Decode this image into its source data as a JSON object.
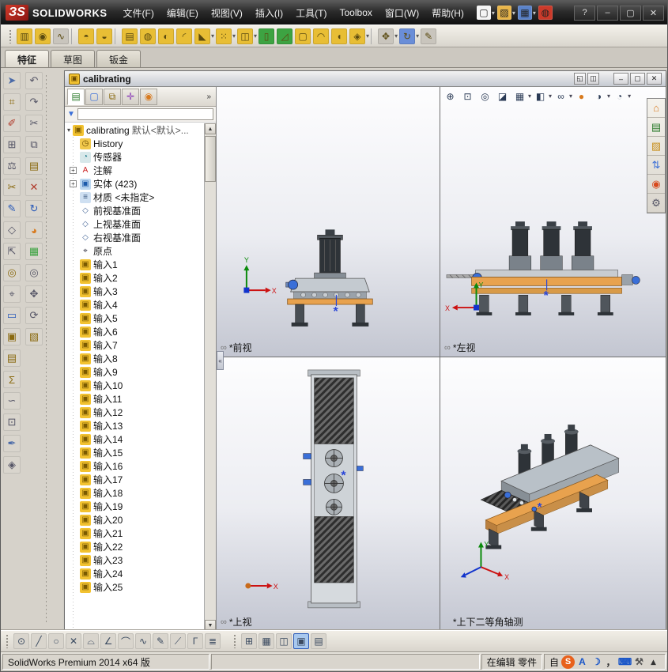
{
  "app": {
    "logo_mark": "ЗS",
    "logo_text": "SOLIDWORKS",
    "menus": [
      "文件(F)",
      "编辑(E)",
      "视图(V)",
      "插入(I)",
      "工具(T)",
      "Toolbox",
      "窗口(W)",
      "帮助(H)"
    ],
    "titlebar_icons": [
      {
        "name": "new-document-icon",
        "glyph": "▢",
        "bg": "#f5f5f5",
        "dd": "▾"
      },
      {
        "name": "open-icon",
        "glyph": "▨",
        "bg": "#e8b54a",
        "dd": "▾"
      },
      {
        "name": "save-icon",
        "glyph": "▦",
        "bg": "#5a82c8",
        "dd": "▾"
      },
      {
        "name": "status-light-icon",
        "glyph": "◍",
        "bg": "#cc3a2a"
      }
    ],
    "help_label": "?",
    "window_controls": [
      {
        "name": "minimize-button",
        "glyph": "‒"
      },
      {
        "name": "maximize-button",
        "glyph": "▢"
      },
      {
        "name": "close-button",
        "glyph": "✕"
      }
    ]
  },
  "toolbar2": [
    {
      "name": "extrude-boss-icon",
      "glyph": "▥",
      "bg": "#e8be35"
    },
    {
      "name": "revolve-boss-icon",
      "glyph": "◉",
      "bg": "#e8be35"
    },
    {
      "name": "swept-boss-icon",
      "glyph": "∿",
      "bg": "#c9c5bd"
    },
    {
      "name": "sep1",
      "sep": "1"
    },
    {
      "name": "notify-up-icon",
      "glyph": "◓",
      "bg": "#e8be35"
    },
    {
      "name": "notify-down-icon",
      "glyph": "◒",
      "bg": "#e8be35"
    },
    {
      "name": "sep2",
      "sep": "1"
    },
    {
      "name": "extrude-cut-icon",
      "glyph": "▤",
      "bg": "#e8be35"
    },
    {
      "name": "hole-wizard-icon",
      "glyph": "◍",
      "bg": "#e8be35"
    },
    {
      "name": "revolved-cut-icon",
      "glyph": "◐",
      "bg": "#e8be35"
    },
    {
      "name": "fillet-icon",
      "glyph": "◜",
      "bg": "#e8be35"
    },
    {
      "name": "chamfer-icon",
      "glyph": "◣",
      "bg": "#e8be35",
      "dd": "▾"
    },
    {
      "name": "linear-pattern-icon",
      "glyph": "⁙",
      "bg": "#e8be35",
      "dd": "▾"
    },
    {
      "name": "mirror-icon",
      "glyph": "◫",
      "bg": "#e8be35",
      "dd": "▾"
    },
    {
      "name": "rib-icon",
      "glyph": "▯",
      "bg": "#3da342"
    },
    {
      "name": "draft-icon",
      "glyph": "◿",
      "bg": "#3da342"
    },
    {
      "name": "shell-icon",
      "glyph": "▢",
      "bg": "#e8be35"
    },
    {
      "name": "wrap-icon",
      "glyph": "◠",
      "bg": "#e8be35"
    },
    {
      "name": "dome-icon",
      "glyph": "◖",
      "bg": "#e8be35"
    },
    {
      "name": "reference-geometry-icon",
      "glyph": "◈",
      "bg": "#e8be35",
      "dd": "▾"
    },
    {
      "name": "sep3",
      "sep": "1"
    },
    {
      "name": "instant3d-icon",
      "glyph": "✥",
      "bg": "#c9c5bd",
      "dd": "▾"
    },
    {
      "name": "rebuild-icon",
      "glyph": "↻",
      "bg": "#6a8ed8",
      "dd": "▾"
    },
    {
      "name": "sketch-pencil-icon",
      "glyph": "✎",
      "bg": "#c9c5bd"
    }
  ],
  "tabs": [
    {
      "label": "特征",
      "active": "true"
    },
    {
      "label": "草图",
      "active": "false"
    },
    {
      "label": "钣金",
      "active": "false"
    }
  ],
  "left_tools_col1": [
    {
      "name": "select-icon",
      "glyph": "➤",
      "fg": "#4a6aa8"
    },
    {
      "name": "dimension-icon",
      "glyph": "⌗",
      "fg": "#8a6a10"
    },
    {
      "name": "note-icon",
      "glyph": "✐",
      "fg": "#b03a2a"
    },
    {
      "name": "measure-icon",
      "glyph": "⊞",
      "fg": "#556"
    },
    {
      "name": "mass-properties-icon",
      "glyph": "⚖",
      "fg": "#556"
    },
    {
      "name": "section-properties-icon",
      "glyph": "✂",
      "fg": "#8a6a10"
    },
    {
      "name": "sketch-edit-icon",
      "glyph": "✎",
      "fg": "#2a5ab8"
    },
    {
      "name": "plane-tool-icon",
      "glyph": "◇",
      "fg": "#556"
    },
    {
      "name": "axis-tool-icon",
      "glyph": "⇱",
      "fg": "#556"
    },
    {
      "name": "point-tool-icon",
      "glyph": "◎",
      "fg": "#8a6a10"
    },
    {
      "name": "coordinate-system-icon",
      "glyph": "⌖",
      "fg": "#556"
    },
    {
      "name": "mate-reference-icon",
      "glyph": "▭",
      "fg": "#2a5ab8"
    },
    {
      "name": "library-feature-icon",
      "glyph": "▣",
      "fg": "#8a6a10"
    },
    {
      "name": "design-table-icon",
      "glyph": "▤",
      "fg": "#8a6a10"
    },
    {
      "name": "equations-icon",
      "glyph": "Σ",
      "fg": "#8a6a10"
    },
    {
      "name": "curves-icon",
      "glyph": "∽",
      "fg": "#556"
    },
    {
      "name": "split-line-icon",
      "glyph": "⊡",
      "fg": "#556"
    },
    {
      "name": "pen-icon",
      "glyph": "✒",
      "fg": "#4a6aa8"
    },
    {
      "name": "dome-tool-icon",
      "glyph": "◈",
      "fg": "#556"
    }
  ],
  "left_tools_col2": [
    {
      "name": "undo-icon",
      "glyph": "↶",
      "fg": "#556"
    },
    {
      "name": "redo-icon",
      "glyph": "↷",
      "fg": "#556"
    },
    {
      "name": "cut-icon",
      "glyph": "✂",
      "fg": "#556"
    },
    {
      "name": "copy-icon",
      "glyph": "⧉",
      "fg": "#556"
    },
    {
      "name": "paste-icon",
      "glyph": "▤",
      "fg": "#8a6a10"
    },
    {
      "name": "delete-icon",
      "glyph": "✕",
      "fg": "#b03a2a"
    },
    {
      "name": "rebuild-small-icon",
      "glyph": "↻",
      "fg": "#2a5ab8"
    },
    {
      "name": "appearance-small-icon",
      "glyph": "◕",
      "fg": "#d87a1e"
    },
    {
      "name": "texture-icon",
      "glyph": "▦",
      "fg": "#3da342"
    },
    {
      "name": "zoom-tool-icon",
      "glyph": "◎",
      "fg": "#556"
    },
    {
      "name": "pan-tool-icon",
      "glyph": "✥",
      "fg": "#556"
    },
    {
      "name": "rotate-view-icon",
      "glyph": "⟳",
      "fg": "#556"
    },
    {
      "name": "standard-views-icon",
      "glyph": "▧",
      "fg": "#8a6a10"
    }
  ],
  "doc": {
    "title": "calibrating",
    "small_controls": [
      {
        "name": "doc-restore-icon",
        "glyph": "◱"
      },
      {
        "name": "doc-split-icon",
        "glyph": "◫"
      }
    ],
    "controls": [
      {
        "name": "doc-minimize-button",
        "glyph": "‒"
      },
      {
        "name": "doc-maximize-button",
        "glyph": "▢"
      },
      {
        "name": "doc-close-button",
        "glyph": "✕"
      }
    ],
    "tree_tabs": [
      {
        "name": "featuremanager-tab",
        "glyph": "▤",
        "fg": "#2a7a2a",
        "active": "true"
      },
      {
        "name": "propertymanager-tab",
        "glyph": "▢",
        "fg": "#3a6fd8",
        "active": "false"
      },
      {
        "name": "configurationmanager-tab",
        "glyph": "⧉",
        "fg": "#8a6a10",
        "active": "false"
      },
      {
        "name": "dimxpert-tab",
        "glyph": "✛",
        "fg": "#8a3ab8",
        "active": "false"
      },
      {
        "name": "displaymanager-tab",
        "glyph": "◉",
        "fg": "#d87a1e",
        "active": "false"
      }
    ],
    "tabs_chevron": "»",
    "filter_value": "",
    "tree": {
      "root_caret": "▾",
      "root_label": "calibrating",
      "root_config": "默认<默认>...",
      "items": [
        {
          "expand": "",
          "glyph": "◷",
          "bg": "#f2c94c",
          "fg": "#6a4a00",
          "label": "History"
        },
        {
          "expand": "",
          "glyph": "◔",
          "bg": "#d8e8ea",
          "fg": "#1a7a8a",
          "label": "传感器"
        },
        {
          "expand": "+",
          "glyph": "A",
          "bg": "#ffffff",
          "fg": "#cc2222",
          "label": "注解"
        },
        {
          "expand": "+",
          "glyph": "▣",
          "bg": "#bcd8f0",
          "fg": "#1a5aaa",
          "label": "实体 (423)"
        },
        {
          "expand": "",
          "glyph": "≡",
          "bg": "#cfe0f2",
          "fg": "#33527a",
          "label": "材质 <未指定>"
        },
        {
          "expand": "",
          "glyph": "◇",
          "bg": "",
          "fg": "#4a6a9a",
          "label": "前视基准面"
        },
        {
          "expand": "",
          "glyph": "◇",
          "bg": "",
          "fg": "#4a6a9a",
          "label": "上视基准面"
        },
        {
          "expand": "",
          "glyph": "◇",
          "bg": "",
          "fg": "#4a6a9a",
          "label": "右视基准面"
        },
        {
          "expand": "",
          "glyph": "⌖",
          "bg": "",
          "fg": "#333344",
          "label": "原点"
        },
        {
          "expand": "",
          "glyph": "▣",
          "bg": "#f2c230",
          "fg": "#7a5a00",
          "label": "输入1"
        },
        {
          "expand": "",
          "glyph": "▣",
          "bg": "#f2c230",
          "fg": "#7a5a00",
          "label": "输入2"
        },
        {
          "expand": "",
          "glyph": "▣",
          "bg": "#f2c230",
          "fg": "#7a5a00",
          "label": "输入3"
        },
        {
          "expand": "",
          "glyph": "▣",
          "bg": "#f2c230",
          "fg": "#7a5a00",
          "label": "输入4"
        },
        {
          "expand": "",
          "glyph": "▣",
          "bg": "#f2c230",
          "fg": "#7a5a00",
          "label": "输入5"
        },
        {
          "expand": "",
          "glyph": "▣",
          "bg": "#f2c230",
          "fg": "#7a5a00",
          "label": "输入6"
        },
        {
          "expand": "",
          "glyph": "▣",
          "bg": "#f2c230",
          "fg": "#7a5a00",
          "label": "输入7"
        },
        {
          "expand": "",
          "glyph": "▣",
          "bg": "#f2c230",
          "fg": "#7a5a00",
          "label": "输入8"
        },
        {
          "expand": "",
          "glyph": "▣",
          "bg": "#f2c230",
          "fg": "#7a5a00",
          "label": "输入9"
        },
        {
          "expand": "",
          "glyph": "▣",
          "bg": "#f2c230",
          "fg": "#7a5a00",
          "label": "输入10"
        },
        {
          "expand": "",
          "glyph": "▣",
          "bg": "#f2c230",
          "fg": "#7a5a00",
          "label": "输入11"
        },
        {
          "expand": "",
          "glyph": "▣",
          "bg": "#f2c230",
          "fg": "#7a5a00",
          "label": "输入12"
        },
        {
          "expand": "",
          "glyph": "▣",
          "bg": "#f2c230",
          "fg": "#7a5a00",
          "label": "输入13"
        },
        {
          "expand": "",
          "glyph": "▣",
          "bg": "#f2c230",
          "fg": "#7a5a00",
          "label": "输入14"
        },
        {
          "expand": "",
          "glyph": "▣",
          "bg": "#f2c230",
          "fg": "#7a5a00",
          "label": "输入15"
        },
        {
          "expand": "",
          "glyph": "▣",
          "bg": "#f2c230",
          "fg": "#7a5a00",
          "label": "输入16"
        },
        {
          "expand": "",
          "glyph": "▣",
          "bg": "#f2c230",
          "fg": "#7a5a00",
          "label": "输入17"
        },
        {
          "expand": "",
          "glyph": "▣",
          "bg": "#f2c230",
          "fg": "#7a5a00",
          "label": "输入18"
        },
        {
          "expand": "",
          "glyph": "▣",
          "bg": "#f2c230",
          "fg": "#7a5a00",
          "label": "输入19"
        },
        {
          "expand": "",
          "glyph": "▣",
          "bg": "#f2c230",
          "fg": "#7a5a00",
          "label": "输入20"
        },
        {
          "expand": "",
          "glyph": "▣",
          "bg": "#f2c230",
          "fg": "#7a5a00",
          "label": "输入21"
        },
        {
          "expand": "",
          "glyph": "▣",
          "bg": "#f2c230",
          "fg": "#7a5a00",
          "label": "输入22"
        },
        {
          "expand": "",
          "glyph": "▣",
          "bg": "#f2c230",
          "fg": "#7a5a00",
          "label": "输入23"
        },
        {
          "expand": "",
          "glyph": "▣",
          "bg": "#f2c230",
          "fg": "#7a5a00",
          "label": "输入24"
        },
        {
          "expand": "",
          "glyph": "▣",
          "bg": "#f2c230",
          "fg": "#7a5a00",
          "label": "输入25"
        }
      ]
    },
    "viewports": {
      "front": {
        "label": "*前视"
      },
      "left": {
        "label": "*左视"
      },
      "top": {
        "label": "*上视"
      },
      "iso": {
        "label": "*上下二等角轴测"
      }
    },
    "collapse_glyph": "«",
    "hud": [
      {
        "name": "zoom-fit-icon",
        "glyph": "⊕"
      },
      {
        "name": "zoom-area-icon",
        "glyph": "⊡"
      },
      {
        "name": "previous-view-icon",
        "glyph": "◎"
      },
      {
        "name": "section-view-icon",
        "glyph": "◪"
      },
      {
        "name": "view-orientation-icon",
        "glyph": "▦",
        "dd": "▾"
      },
      {
        "name": "display-style-icon",
        "glyph": "◧",
        "dd": "▾"
      },
      {
        "name": "hide-show-items-icon",
        "glyph": "∞",
        "dd": "▾"
      },
      {
        "name": "edit-appearance-icon",
        "glyph": "●",
        "fg": "#d87a1e"
      },
      {
        "name": "apply-scene-icon",
        "glyph": "◑",
        "dd": "▾"
      },
      {
        "name": "view-settings-icon",
        "glyph": "◔",
        "dd": "▾"
      }
    ],
    "rpane": [
      {
        "name": "home-icon",
        "glyph": "⌂",
        "fg": "#d87a1e"
      },
      {
        "name": "design-library-icon",
        "glyph": "▤",
        "fg": "#2a7a2a"
      },
      {
        "name": "file-explorer-icon",
        "glyph": "▨",
        "fg": "#c8901e"
      },
      {
        "name": "search-arrows-icon",
        "glyph": "⇅",
        "fg": "#3a6fd8"
      },
      {
        "name": "appearances-icon",
        "glyph": "◉",
        "fg": "#d84a1e"
      },
      {
        "name": "custom-properties-icon",
        "glyph": "⚙",
        "fg": "#556"
      }
    ]
  },
  "bottom_tools": [
    {
      "name": "circle-tool-icon",
      "glyph": "⊙"
    },
    {
      "name": "line-tool-icon",
      "glyph": "╱"
    },
    {
      "name": "ellipse-tool-icon",
      "glyph": "○"
    },
    {
      "name": "trim-tool-icon",
      "glyph": "✕"
    },
    {
      "name": "arc-tool-icon",
      "glyph": "⌓"
    },
    {
      "name": "angle-tool-icon",
      "glyph": "∠"
    },
    {
      "name": "fillet-tool-icon",
      "glyph": "⌒"
    },
    {
      "name": "spline-tool-icon",
      "glyph": "∿"
    },
    {
      "name": "sketch-tool-icon",
      "glyph": "✎"
    },
    {
      "name": "mirror-tool-icon",
      "glyph": "⟋"
    },
    {
      "name": "corner-tool-icon",
      "glyph": "Γ"
    },
    {
      "name": "pattern-tool-icon",
      "glyph": "≣"
    }
  ],
  "bottom_views": [
    {
      "name": "single-view-icon",
      "glyph": "⊞",
      "active": "false"
    },
    {
      "name": "two-view-horizontal-icon",
      "glyph": "▦",
      "active": "false"
    },
    {
      "name": "two-view-vertical-icon",
      "glyph": "◫",
      "active": "false"
    },
    {
      "name": "four-view-icon",
      "glyph": "▣",
      "active": "true"
    },
    {
      "name": "link-views-icon",
      "glyph": "▤",
      "active": "false"
    }
  ],
  "statusbar": {
    "left_text": "SolidWorks Premium 2014 x64 版",
    "mode_text": "在编辑 零件",
    "tray_prefix": "自",
    "tray": [
      {
        "name": "sogou-input-icon",
        "glyph": "S",
        "bg": "#e8611c",
        "round": "1"
      },
      {
        "name": "language-a-icon",
        "glyph": "A",
        "fg": "#1a56c8"
      },
      {
        "name": "moon-icon",
        "glyph": "☽",
        "fg": "#1a56c8"
      },
      {
        "name": "punctuation-icon",
        "glyph": "，",
        "fg": "#333333"
      },
      {
        "name": "keyboard-icon",
        "glyph": "⌨",
        "fg": "#1a56c8"
      },
      {
        "name": "wrench-icon",
        "glyph": "⚒",
        "fg": "#555555"
      },
      {
        "name": "tray-expand-icon",
        "glyph": "▴",
        "fg": "#333333"
      }
    ]
  }
}
